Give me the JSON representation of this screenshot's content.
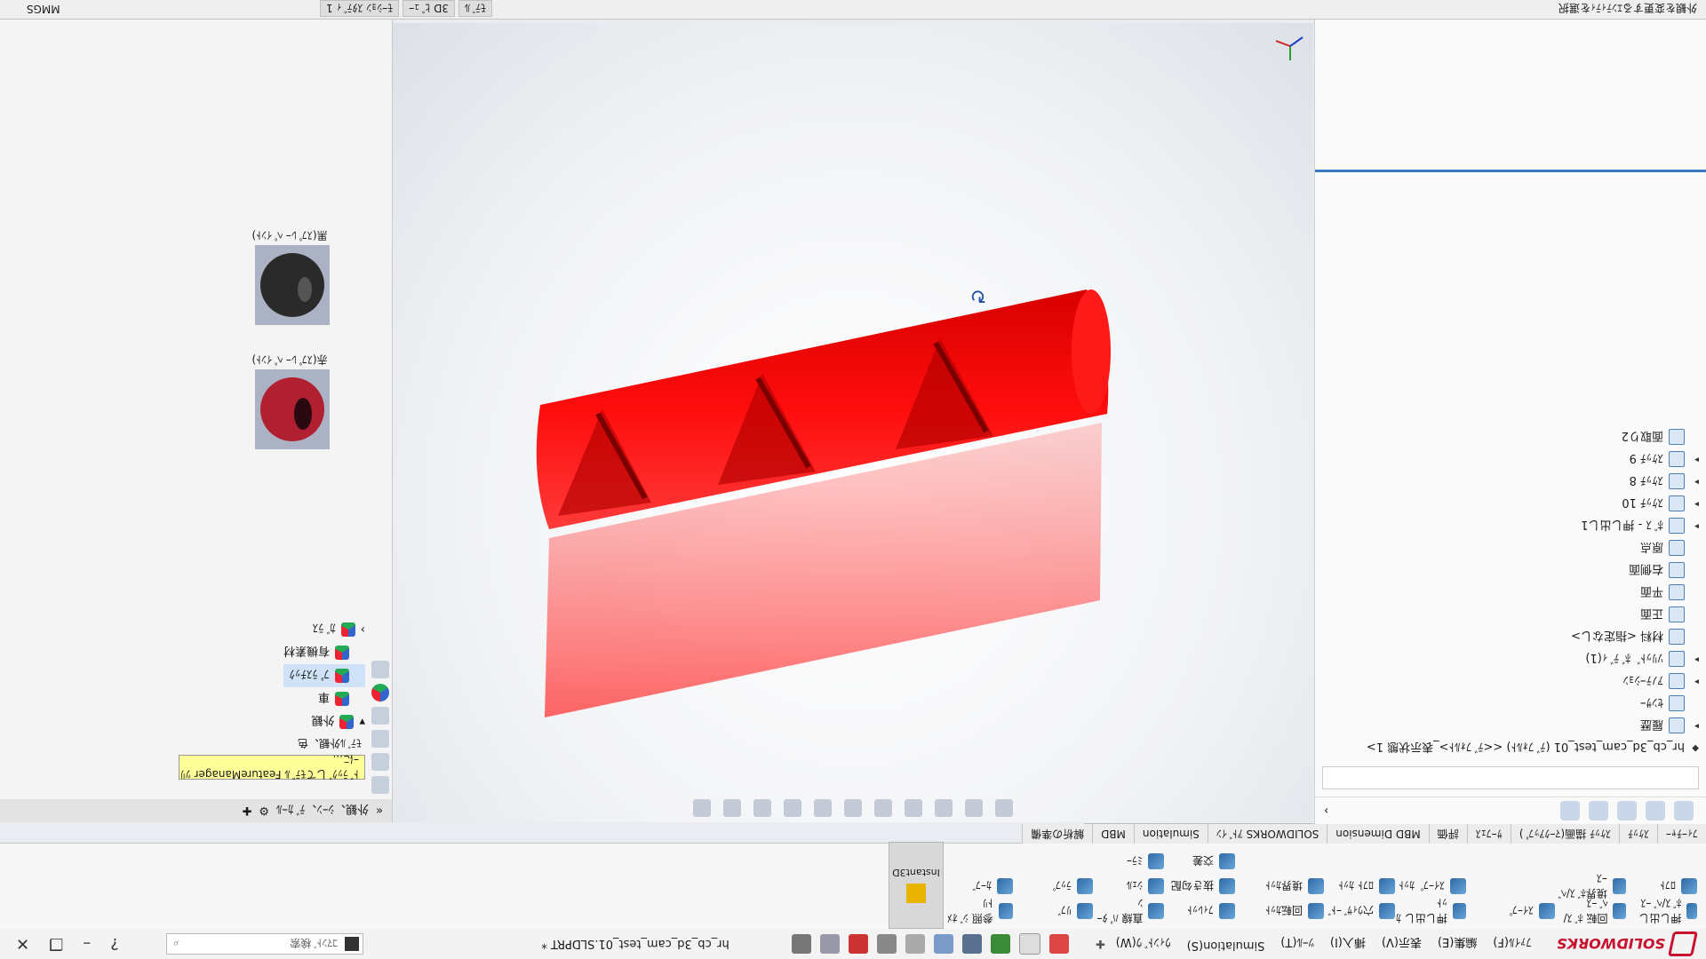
{
  "app": {
    "name": "SOLIDWORKS",
    "document_title": "hr_cb_3d_cam_test_01.SLDPRT *",
    "search_placeholder": "ｺﾏﾝﾄﾞ検索",
    "measure_unit": "MMGS"
  },
  "menus": [
    "ﾌｧｲﾙ(F)",
    "編集(E)",
    "表示(V)",
    "挿入(I)",
    "ﾂｰﾙ(T)",
    "Simulation(S)",
    "ｳｨﾝﾄﾞｳ(W)"
  ],
  "ribbon": {
    "group1": [
      "押し出し ﾎﾞｽ/ﾍﾞｰｽ",
      "回転 ﾎﾞｽ/ﾍﾞｰｽ",
      "ｽｲｰﾌﾟ",
      "ﾛﾌﾄ",
      "境界ﾎﾞｽ/ﾍﾞｰｽ"
    ],
    "group2": [
      "押し出し ｶｯﾄ",
      "穴ｳｨｻﾞｰﾄﾞ",
      "回転ｶｯﾄ",
      "ｽｲｰﾌﾟ ｶｯﾄ",
      "ﾛﾌﾄ ｶｯﾄ",
      "境界ｶｯﾄ"
    ],
    "group3": [
      "ﾌｨﾚｯﾄ",
      "直線 ﾊﾟﾀｰﾝ",
      "ﾘﾌﾞ",
      "抜き勾配",
      "ｼｪﾙ",
      "ﾗｯﾌﾟ",
      "交差",
      "ﾐﾗｰ"
    ],
    "group4": [
      "参照 ｼﾞｵﾒﾄﾘ",
      "ｶｰﾌﾞ"
    ],
    "instant3d": "Instant3D"
  },
  "tabs": [
    "ﾌｨｰﾁｬｰ",
    "ｽｹｯﾁ",
    "ｽｹｯﾁ 描画(ﾏｰｸｱｯﾌﾟ)",
    "ｻｰﾌｪｽ",
    "評価",
    "MBD Dimension",
    "SOLIDWORKS ｱﾄﾞｲﾝ",
    "Simulation",
    "MBD",
    "解析の準備"
  ],
  "feature_manager": {
    "root": "hr_cb_3d_cam_test_01 (ﾃﾞﾌｫﾙﾄ) <<ﾃﾞﾌｫﾙﾄ>_表示状態 1>",
    "items": [
      {
        "label": "履歴",
        "arrow": "▸"
      },
      {
        "label": "ｾﾝｻｰ",
        "arrow": ""
      },
      {
        "label": "ｱﾉﾃｰｼｮﾝ",
        "arrow": "▸"
      },
      {
        "label": "ｿﾘｯﾄﾞ ﾎﾞﾃﾞｨ(1)",
        "arrow": "▸"
      },
      {
        "label": "材料 <指定なし>",
        "arrow": ""
      },
      {
        "label": "正面",
        "arrow": ""
      },
      {
        "label": "平面",
        "arrow": ""
      },
      {
        "label": "右側面",
        "arrow": ""
      },
      {
        "label": "原点",
        "arrow": ""
      },
      {
        "label": "ﾎﾞｽ - 押し出し1",
        "arrow": "▸"
      },
      {
        "label": "ｽｹｯﾁ 10",
        "arrow": "▸"
      },
      {
        "label": "ｽｹｯﾁ 8",
        "arrow": "▸"
      },
      {
        "label": "ｽｹｯﾁ 9",
        "arrow": "▸"
      },
      {
        "label": "面取り2",
        "arrow": ""
      }
    ]
  },
  "viewport_toolbar": {
    "title_tabs": [
      "ﾓﾃﾞﾙ",
      "3D ﾋﾞｭｰ",
      "ﾓｰｼｮﾝ ｽﾀﾃﾞｨ 1"
    ]
  },
  "task_pane": {
    "title": "外観、ｼｰﾝ、ﾃﾞｶｰﾙ",
    "tooltip": "ﾄﾞﾗｯｸﾞしてﾓﾃﾞﾙ FeatureManager ﾂﾘｰに...",
    "section": "ﾓﾃﾞﾙ外観、色",
    "tree": [
      "外観",
      "車",
      "ﾌﾟﾗｽﾁｯｸ",
      "有機素材",
      "ｶﾞﾗｽ"
    ],
    "swatches": [
      {
        "label": "赤(ｽﾌﾟﾚｰ ﾍﾟｲﾝﾄ)",
        "color": "#b02030"
      },
      {
        "label": "黒(ｽﾌﾟﾚｰ ﾍﾟｲﾝﾄ)",
        "color": "#2a2a2a"
      }
    ]
  },
  "statusbar": {
    "tabs": [
      "ﾓﾃﾞﾙ",
      "3D ﾋﾞｭｰ",
      "ﾓｰｼｮﾝ ｽﾀﾃﾞｨ 1"
    ],
    "right": [
      "MMGS"
    ],
    "hint": "外観を変更するｴﾝﾃｨﾃｨを選択"
  },
  "colors": {
    "part_red": "#ff1010",
    "selection_blue": "#3b78c5"
  }
}
